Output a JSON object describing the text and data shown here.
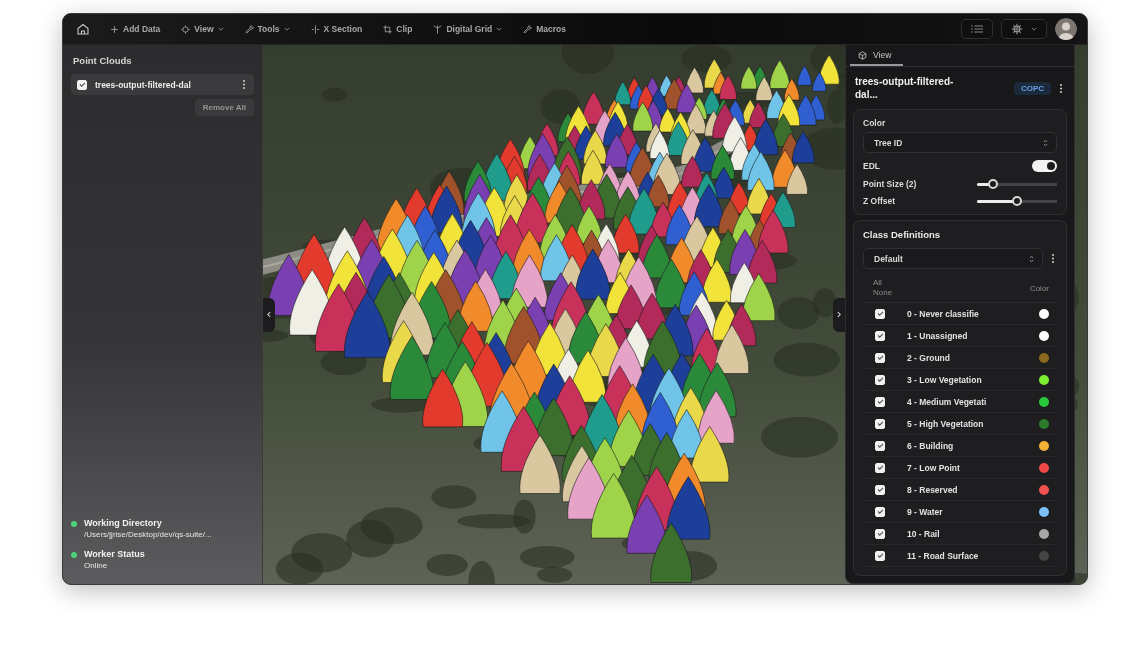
{
  "toolbar": {
    "items": [
      {
        "label": "Add Data",
        "menu": false
      },
      {
        "label": "View",
        "menu": true
      },
      {
        "label": "Tools",
        "menu": true
      },
      {
        "label": "X Section",
        "menu": false
      },
      {
        "label": "Clip",
        "menu": false
      },
      {
        "label": "Digital Grid",
        "menu": true
      },
      {
        "label": "Macros",
        "menu": false
      }
    ]
  },
  "point_clouds": {
    "title": "Point Clouds",
    "items": [
      {
        "name": "trees-output-filtered-dal",
        "checked": true
      }
    ],
    "remove_all": "Remove All"
  },
  "status": [
    {
      "label": "Working Directory",
      "value": "/Users/jjrise/Desktop/dev/qs-suite/..."
    },
    {
      "label": "Worker Status",
      "value": "Online"
    }
  ],
  "inspector": {
    "tabs": [
      {
        "label": "View",
        "selected": true
      }
    ],
    "title": "trees-output-filtered-dal...",
    "badge": "COPC",
    "color": {
      "label": "Color",
      "value": "Tree ID"
    },
    "edl": {
      "label": "EDL",
      "on": true
    },
    "sliders": [
      {
        "label": "Point Size (2)",
        "level": 0.15
      },
      {
        "label": "Z Offset",
        "level": 0.5
      }
    ]
  },
  "class_definitions": {
    "title": "Class Definitions",
    "preset": "Default",
    "all": "All",
    "none": "None",
    "color_header": "Color",
    "classes": [
      {
        "label": "0 - Never classifie",
        "checked": true,
        "color": "#ffffff"
      },
      {
        "label": "1 - Unassigned",
        "checked": true,
        "color": "#ffffff"
      },
      {
        "label": "2 - Ground",
        "checked": true,
        "color": "#8a6a1e"
      },
      {
        "label": "3 - Low Vegetation",
        "checked": true,
        "color": "#7ef032"
      },
      {
        "label": "4 - Medium Vegetati",
        "checked": true,
        "color": "#28c83c"
      },
      {
        "label": "5 - High Vegetation",
        "checked": true,
        "color": "#2d7a2d"
      },
      {
        "label": "6 - Building",
        "checked": true,
        "color": "#f5b335"
      },
      {
        "label": "7 - Low Point",
        "checked": true,
        "color": "#f04848"
      },
      {
        "label": "8 - Reserved",
        "checked": true,
        "color": "#f05252"
      },
      {
        "label": "9 - Water",
        "checked": true,
        "color": "#80c0f8"
      },
      {
        "label": "10 - Rail",
        "checked": true,
        "color": "#a8a8a8"
      },
      {
        "label": "11 - Road Surface",
        "checked": true,
        "color": "#454545"
      }
    ]
  }
}
